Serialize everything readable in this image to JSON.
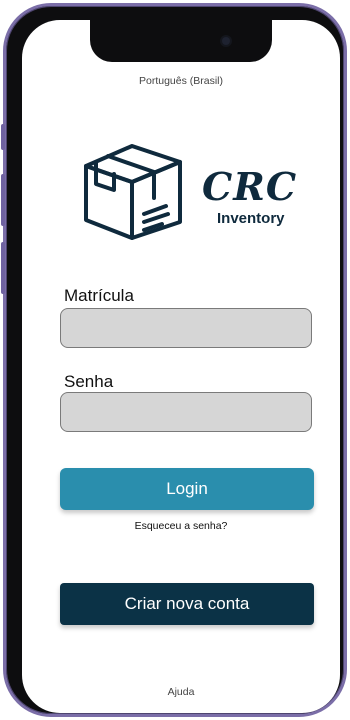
{
  "language": "Português (Brasil)",
  "logo": {
    "title": "CRC",
    "subtitle": "Inventory",
    "icon": "package-box-icon"
  },
  "form": {
    "matricula_label": "Matrícula",
    "matricula_value": "",
    "senha_label": "Senha",
    "senha_value": ""
  },
  "actions": {
    "login_label": "Login",
    "forgot_label": "Esqueceu a senha?",
    "create_label": "Criar nova conta",
    "help_label": "Ajuda"
  },
  "colors": {
    "login_button": "#2a8ead",
    "create_button": "#0b3246",
    "brand_text": "#0f2a3d",
    "input_background": "#d6d6d6",
    "phone_frame": "#7b6ea8"
  }
}
